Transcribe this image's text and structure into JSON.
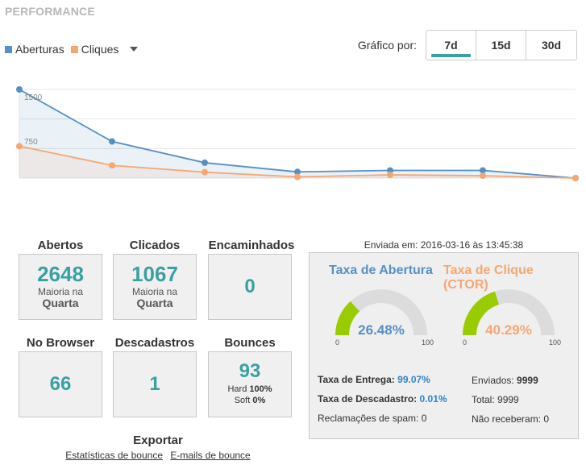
{
  "section_title": "PERFORMANCE",
  "legend": {
    "opens_label": "Aberturas",
    "clicks_label": "Cliques",
    "opens_color": "#5590c5",
    "clicks_color": "#f5a772"
  },
  "chart_by": {
    "label": "Gráfico por:",
    "options": [
      "7d",
      "15d",
      "30d"
    ],
    "active": "7d"
  },
  "chart_data": {
    "type": "area",
    "yticks": [
      "1500",
      "750"
    ],
    "ylim": [
      0,
      1500
    ],
    "series": [
      {
        "name": "Aberturas",
        "values": [
          1500,
          620,
          260,
          105,
          130,
          130,
          0
        ]
      },
      {
        "name": "Cliques",
        "values": [
          540,
          215,
          100,
          20,
          55,
          40,
          0
        ]
      }
    ]
  },
  "stats": {
    "abertos": {
      "label": "Abertos",
      "value": "2648",
      "sub": "Maioria na",
      "day": "Quarta"
    },
    "clicados": {
      "label": "Clicados",
      "value": "1067",
      "sub": "Maioria na",
      "day": "Quarta"
    },
    "encaminhados": {
      "label": "Encaminhados",
      "value": "0"
    },
    "no_browser": {
      "label": "No Browser",
      "value": "66"
    },
    "descadastros": {
      "label": "Descadastros",
      "value": "1"
    },
    "bounces": {
      "label": "Bounces",
      "value": "93",
      "hard_label": "Hard",
      "hard_value": "100%",
      "soft_label": "Soft",
      "soft_value": "0%"
    }
  },
  "export": {
    "title": "Exportar",
    "link_stats": "Estatísticas de bounce",
    "link_emails": "E-mails de bounce"
  },
  "sent_at": "Enviada em: 2016-03-16 às 13:45:38",
  "rates": {
    "open_title": "Taxa de Abertura",
    "open_value": "26.48%",
    "open_fraction": 0.2648,
    "open_color": "#5590c5",
    "click_title": "Taxa de Clique (CTOR)",
    "click_value": "40.29%",
    "click_fraction": 0.4029,
    "click_color": "#f5a772",
    "gauge_fill": "#99cc00",
    "gauge_track": "#dcdcdc",
    "gauge_min": "0",
    "gauge_max": "100"
  },
  "details": {
    "delivery_label": "Taxa de Entrega:",
    "delivery_value": "99.07%",
    "unsub_label": "Taxa de Descadastro:",
    "unsub_value": "0.01%",
    "spam_label": "Reclamações de spam:",
    "spam_value": "0",
    "sent_label": "Enviados:",
    "sent_value": "9999",
    "total_label": "Total:",
    "total_value": "9999",
    "not_received_label": "Não receberam:",
    "not_received_value": "0"
  }
}
